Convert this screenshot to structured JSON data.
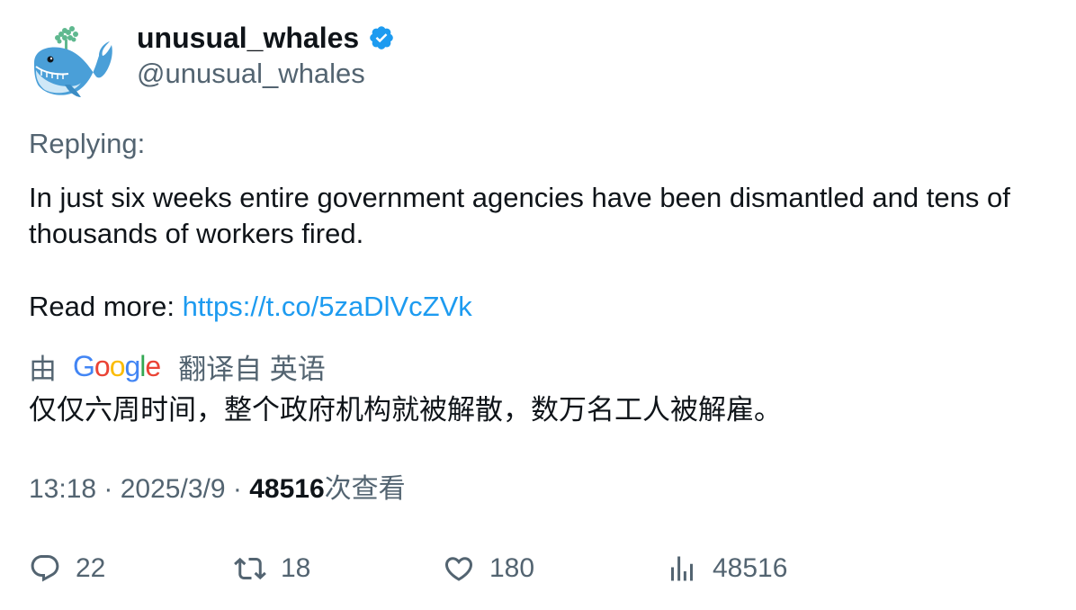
{
  "author": {
    "display_name": "unusual_whales",
    "handle": "@unusual_whales",
    "verified": true,
    "avatar_icon": "whale-icon"
  },
  "replying": "Replying:",
  "body": {
    "text": "In just six weeks entire government agencies have been dismantled and tens of thousands of workers fired.",
    "read_more_label": "Read more: ",
    "link": "https://t.co/5zaDlVcZVk"
  },
  "translation": {
    "prefix": "由",
    "provider": "Google",
    "suffix": "翻译自 英语",
    "text": "仅仅六周时间，整个政府机构就被解散，数万名工人被解雇。"
  },
  "meta": {
    "time": "13:18",
    "separator": " · ",
    "date": "2025/3/9",
    "views": "48516",
    "views_label": "次查看"
  },
  "actions": {
    "replies": "22",
    "retweets": "18",
    "likes": "180",
    "views": "48516"
  },
  "colors": {
    "link": "#1d9bf0",
    "secondary": "#536471",
    "verified": "#1d9bf0"
  }
}
